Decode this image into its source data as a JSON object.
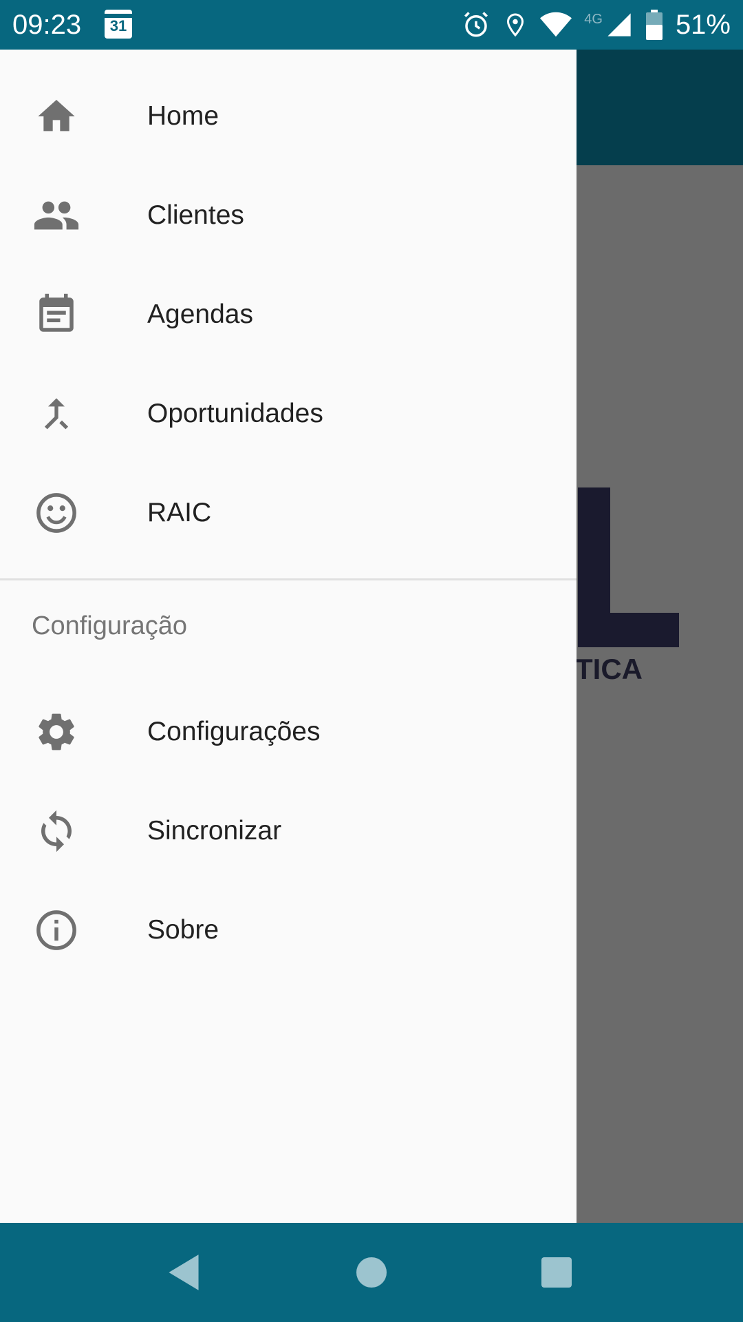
{
  "status_bar": {
    "time": "09:23",
    "calendar_day": "31",
    "network": "4G",
    "battery": "51%"
  },
  "background_app": {
    "logo_text": "TICA"
  },
  "drawer": {
    "items": [
      {
        "label": "Home",
        "icon": "home-icon"
      },
      {
        "label": "Clientes",
        "icon": "people-icon"
      },
      {
        "label": "Agendas",
        "icon": "calendar-note-icon"
      },
      {
        "label": "Oportunidades",
        "icon": "merge-icon"
      },
      {
        "label": "RAIC",
        "icon": "smiley-icon"
      }
    ],
    "section_title": "Configuração",
    "settings_items": [
      {
        "label": "Configurações",
        "icon": "gear-icon"
      },
      {
        "label": "Sincronizar",
        "icon": "sync-icon"
      },
      {
        "label": "Sobre",
        "icon": "info-icon"
      }
    ]
  },
  "colors": {
    "primary": "#07677f",
    "toolbar_dark": "#053e4d",
    "drawer_bg": "#fafafa",
    "icon": "#707070",
    "text": "#212121"
  }
}
